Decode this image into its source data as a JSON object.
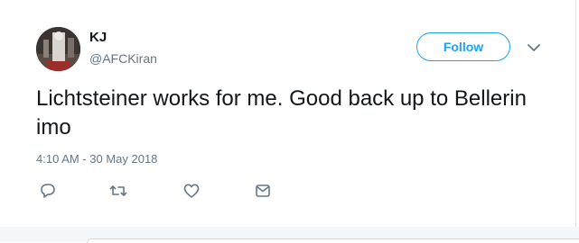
{
  "tweet": {
    "author_name": "KJ",
    "author_handle": "@AFCKiran",
    "follow_label": "Follow",
    "text": "Lichtsteiner works for me. Good back up to Bellerin imo",
    "timestamp": "4:10 AM - 30 May 2018"
  },
  "icons": {
    "caret": "chevron-down-icon",
    "reply": "reply-icon",
    "retweet": "retweet-icon",
    "like": "heart-icon",
    "dm": "envelope-icon"
  },
  "colors": {
    "accent": "#1da1f2",
    "text": "#14171a",
    "secondary": "#657786"
  }
}
